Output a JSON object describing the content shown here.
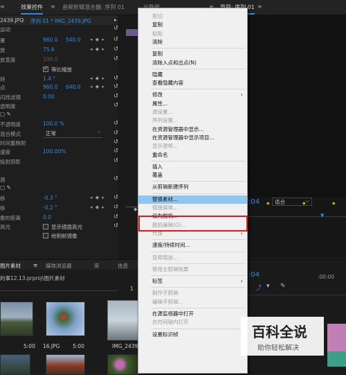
{
  "tabs": {
    "effects": "效果控件",
    "mixer": "音频剪辑混合器: 序列 01",
    "metadata": "元数据",
    "program": "节目: 序列 01"
  },
  "effects_header": {
    "source_clip": "2439.JPG",
    "sequence_clip": "序列 01 * IMG_2439.JPG"
  },
  "effect_rows": [
    {
      "label": "运动"
    },
    {
      "label": "置",
      "v1": "960.0",
      "v2": "540.0"
    },
    {
      "label": "放",
      "v1": "75.6"
    },
    {
      "label": "放宽度",
      "v1": "100.0",
      "dim": true
    },
    {
      "label": "",
      "checkbox_label": "等比缩放"
    },
    {
      "label": "转",
      "v1": "1.4 °"
    },
    {
      "label": "点",
      "v1": "960.0",
      "v2": "640.0"
    },
    {
      "label": "闪烁滤镜",
      "v1": "0.00"
    },
    {
      "label": "透明度"
    },
    {
      "label": "",
      "icons": true
    },
    {
      "label": "不透明度",
      "v1": "100.0 %"
    },
    {
      "label": "混合模式",
      "select": "正常"
    },
    {
      "label": "时间重映射"
    },
    {
      "label": "速度",
      "v1": "100.00%"
    },
    {
      "label": "投射阴影"
    },
    {
      "label": ""
    },
    {
      "label": "源"
    },
    {
      "label": "",
      "icons": true
    },
    {
      "label": "移",
      "v1": "-0.3 °"
    },
    {
      "label": "移",
      "v1": "-0.2 °"
    },
    {
      "label": "像的距离",
      "v1": "0.0"
    },
    {
      "label": "高光",
      "checkbox_label": "显示镜面高光"
    },
    {
      "label": "",
      "checkbox_label": "绘制前镜像"
    }
  ],
  "project_panel": {
    "tab1": "图片素材",
    "tab2": "媒体浏览器",
    "tab3": "库",
    "tab4": "信息",
    "path": "的事12.13.prproj\\图片素材",
    "thumbs": [
      {
        "name": "",
        "duration": "5:00"
      },
      {
        "name": "16.JPG",
        "duration": "5:00"
      },
      {
        "name": "IMG_2439.JPG",
        "duration": "5:00"
      }
    ]
  },
  "program_monitor": {
    "timecode": ":04",
    "fit": "适合"
  },
  "timeline": {
    "timecode": ":04",
    "ruler": ":00:00"
  },
  "context_menu": {
    "items": [
      {
        "label": "剪切",
        "disabled": true
      },
      {
        "label": "复制",
        "disabled": false
      },
      {
        "label": "粘贴",
        "disabled": true
      },
      {
        "label": "清除",
        "disabled": false
      },
      {
        "sep": true
      },
      {
        "label": "复制",
        "disabled": false
      },
      {
        "label": "清除入点和出点(N)",
        "disabled": false
      },
      {
        "sep": true
      },
      {
        "label": "隐藏",
        "disabled": false
      },
      {
        "label": "查看隐藏内容",
        "disabled": false
      },
      {
        "sep": true
      },
      {
        "label": "修改",
        "disabled": false,
        "submenu": true
      },
      {
        "label": "属性...",
        "disabled": false
      },
      {
        "label": "源设置...",
        "disabled": true
      },
      {
        "label": "序列设置...",
        "disabled": true
      },
      {
        "label": "在资源管理器中显示...",
        "disabled": false
      },
      {
        "label": "在资源管理器中显示项目...",
        "disabled": false
      },
      {
        "label": "显示源帧...",
        "disabled": true
      },
      {
        "label": "重命名",
        "disabled": false
      },
      {
        "sep": true
      },
      {
        "label": "插入",
        "disabled": false
      },
      {
        "label": "覆盖",
        "disabled": false
      },
      {
        "sep": true
      },
      {
        "label": "从剪辑新建序列",
        "disabled": false
      },
      {
        "sep": true
      },
      {
        "label": "替换素材...",
        "disabled": false,
        "highlighted": true
      },
      {
        "label": "链接媒体...",
        "disabled": true
      },
      {
        "label": "设为脱机...",
        "disabled": false
      },
      {
        "label": "脱机编辑(O)...",
        "disabled": true
      },
      {
        "label": "代理",
        "disabled": true,
        "submenu": true
      },
      {
        "sep": true
      },
      {
        "label": "速度/持续时间...",
        "disabled": false
      },
      {
        "sep": true
      },
      {
        "label": "音频增益...",
        "disabled": true
      },
      {
        "sep": true
      },
      {
        "label": "禁用主剪辑效果",
        "disabled": true
      },
      {
        "sep": true
      },
      {
        "label": "标签",
        "disabled": false,
        "submenu": true
      },
      {
        "sep": true
      },
      {
        "label": "制作子剪辑",
        "disabled": true
      },
      {
        "label": "编辑子剪辑...",
        "disabled": true
      },
      {
        "sep": true
      },
      {
        "label": "在源监视器中打开",
        "disabled": false
      },
      {
        "label": "在时间轴内打开",
        "disabled": true
      },
      {
        "sep": true
      },
      {
        "label": "设置标识帧",
        "disabled": false
      }
    ]
  },
  "watermark": {
    "title": "百科全说",
    "subtitle": "助你轻松解决"
  },
  "colors": {
    "accent": "#2d8ceb",
    "highlight": "#8fc5ef",
    "callout": "#e11818"
  }
}
